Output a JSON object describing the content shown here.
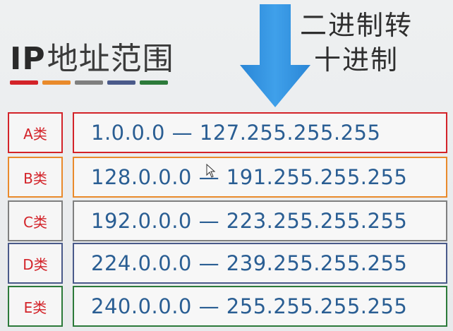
{
  "title": {
    "ip": "IP",
    "cn": "地址范围",
    "underline_colors": [
      "#d32329",
      "#e98a2b",
      "#7f7f7f",
      "#4a5a8a",
      "#2c7a3a"
    ]
  },
  "convert_note": {
    "line1": "二进制转",
    "line2": "十进制"
  },
  "arrow": {
    "icon": "down-arrow-icon",
    "color": "#2f8fdc"
  },
  "rows": [
    {
      "class_label": "A类",
      "range": "1.0.0.0 — 127.255.255.255",
      "color": "#d32329"
    },
    {
      "class_label": "B类",
      "range": "128.0.0.0 — 191.255.255.255",
      "color": "#e98a2b"
    },
    {
      "class_label": "C类",
      "range": "192.0.0.0 — 223.255.255.255",
      "color": "#7f7f7f"
    },
    {
      "class_label": "D类",
      "range": "224.0.0.0 — 239.255.255.255",
      "color": "#4a5a8a"
    },
    {
      "class_label": "E类",
      "range": "240.0.0.0 — 255.255.255.255",
      "color": "#2c7a3a"
    }
  ]
}
